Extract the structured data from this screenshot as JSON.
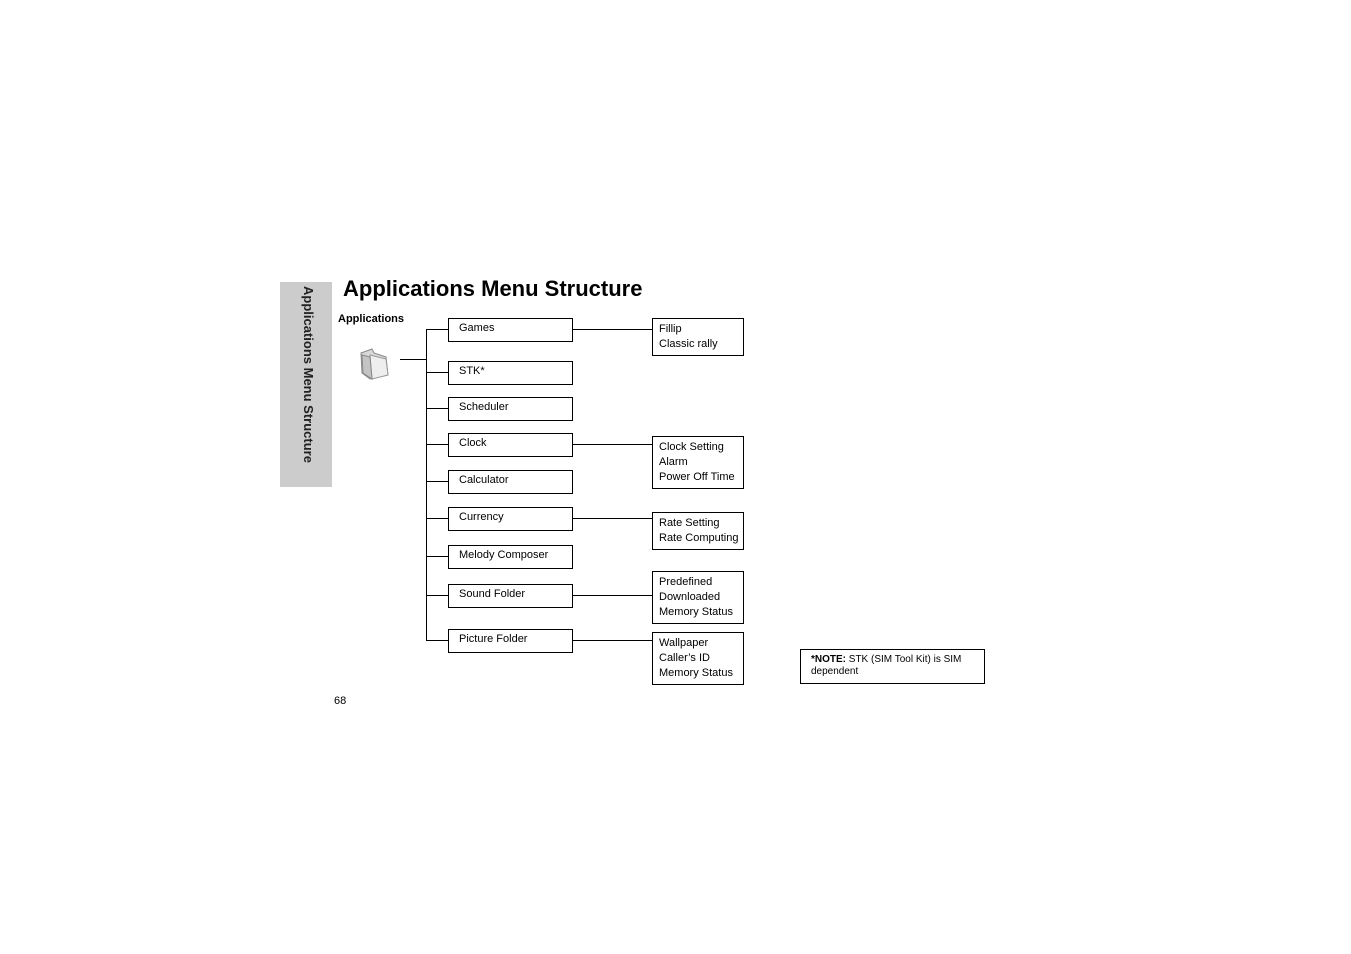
{
  "side_tab": {
    "label": "Applications Menu Structure"
  },
  "page_title": "Applications Menu Structure",
  "root": {
    "label": "Applications",
    "icon": "folder-icon"
  },
  "menu": [
    {
      "label": "Games",
      "submenu": [
        "Fillip",
        "Classic rally"
      ]
    },
    {
      "label": "STK*",
      "submenu": []
    },
    {
      "label": "Scheduler",
      "submenu": []
    },
    {
      "label": "Clock",
      "submenu": [
        "Clock Setting",
        "Alarm",
        "Power Off Time"
      ]
    },
    {
      "label": "Calculator",
      "submenu": []
    },
    {
      "label": "Currency",
      "submenu": [
        "Rate Setting",
        "Rate Computing"
      ]
    },
    {
      "label": "Melody Composer",
      "submenu": []
    },
    {
      "label": "Sound Folder",
      "submenu": [
        "Predefined",
        "Downloaded",
        "Memory Status"
      ]
    },
    {
      "label": "Picture Folder",
      "submenu": [
        "Wallpaper",
        "Caller’s ID",
        "Memory Status"
      ]
    }
  ],
  "note": {
    "prefix": "*NOTE:",
    "text": " STK (SIM Tool Kit) is SIM dependent"
  },
  "page_number": "68"
}
